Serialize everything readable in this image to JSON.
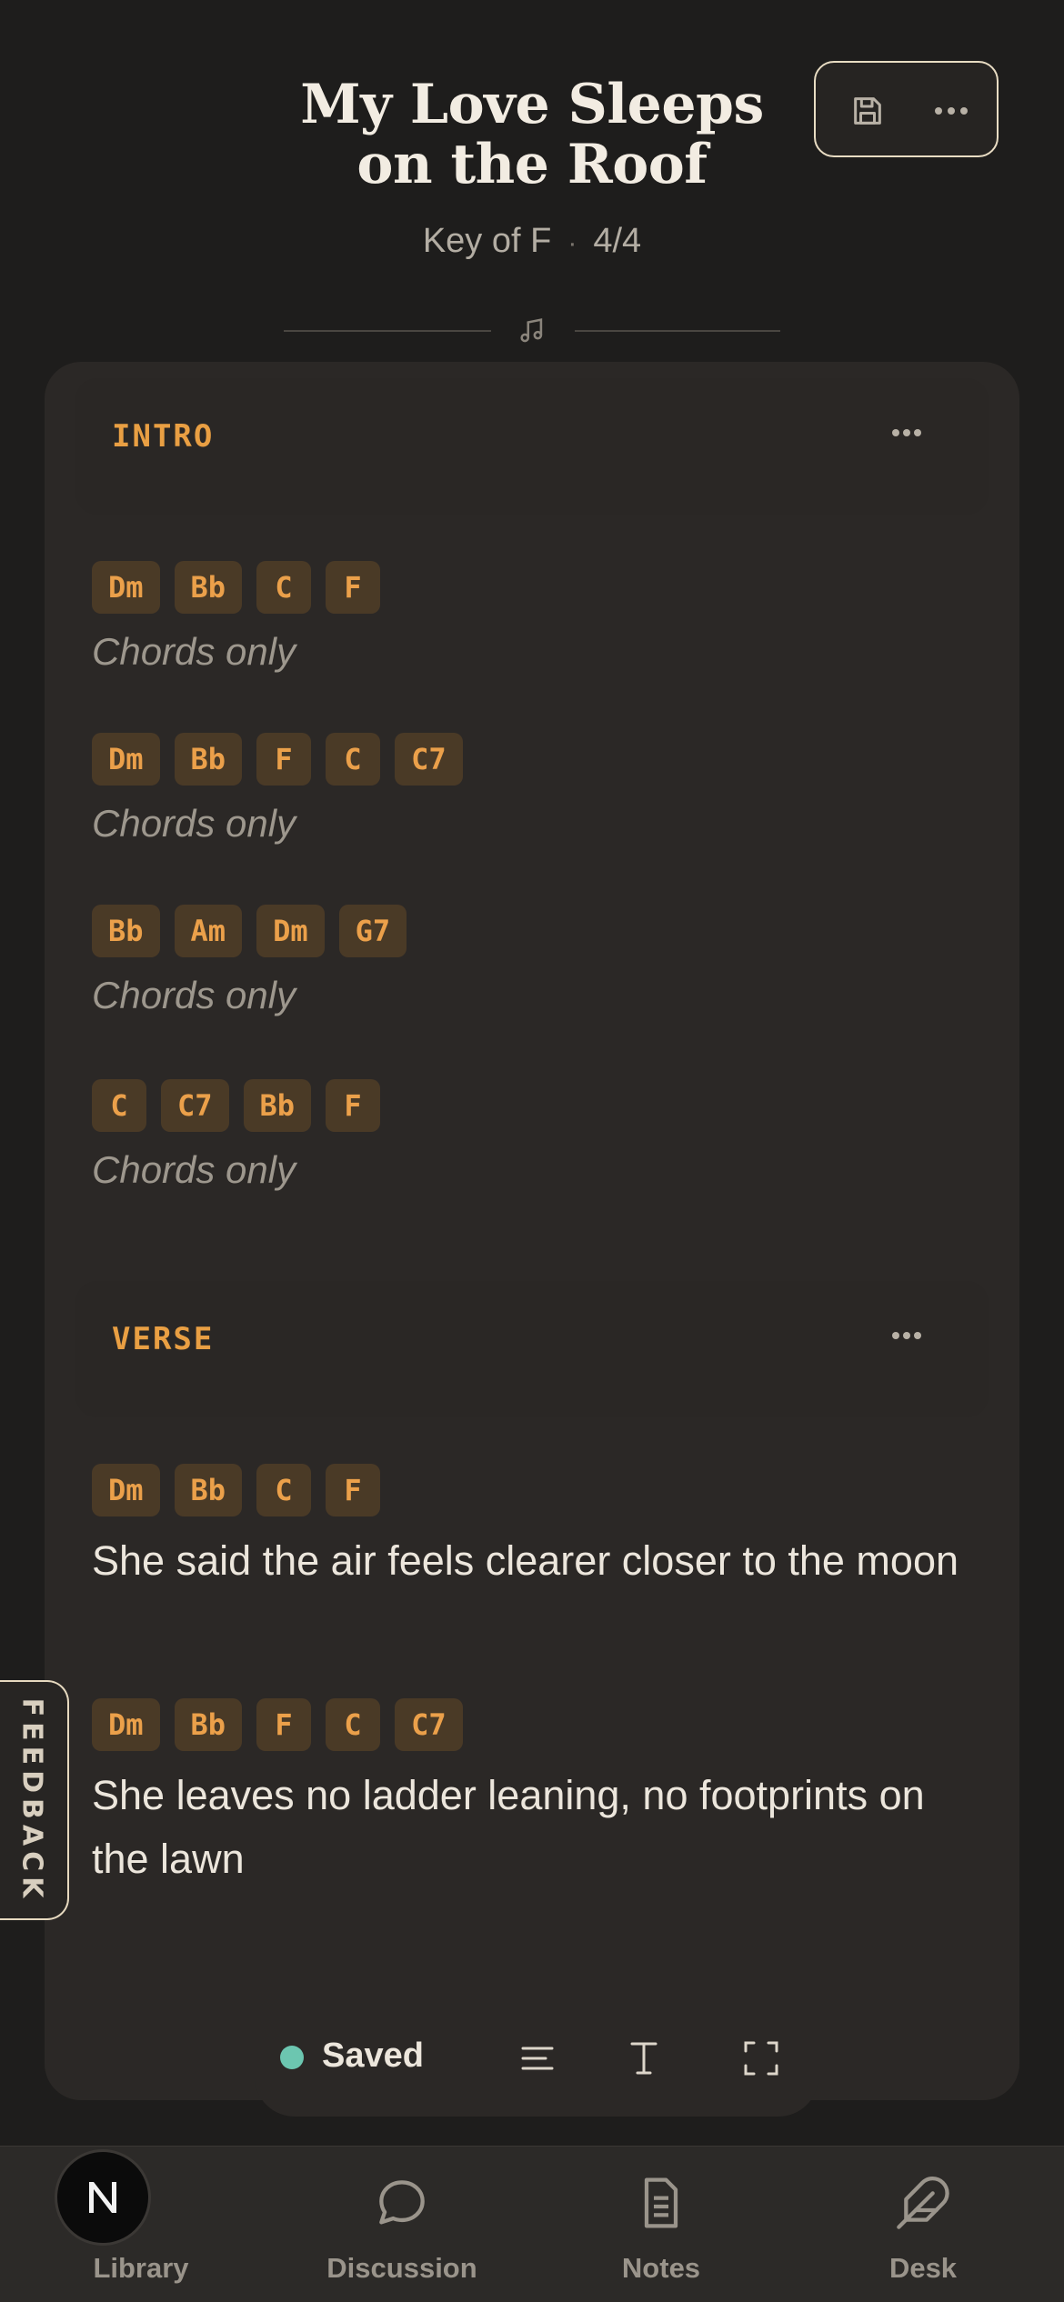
{
  "song": {
    "title_line1": "My Love Sleeps",
    "title_line2": "on the Roof",
    "key": "Key of F",
    "meta_separator": "·",
    "time_signature": "4/4"
  },
  "header_actions": [
    {
      "name": "save",
      "icon": "floppy-disk-icon"
    },
    {
      "name": "more",
      "icon": "ellipsis-icon"
    }
  ],
  "sections": [
    {
      "label": "INTRO",
      "lines": [
        {
          "chords": [
            "Dm",
            "Bb",
            "C",
            "F"
          ],
          "text": "Chords only",
          "placeholder": true
        },
        {
          "chords": [
            "Dm",
            "Bb",
            "F",
            "C",
            "C7"
          ],
          "text": "Chords only",
          "placeholder": true
        },
        {
          "chords": [
            "Bb",
            "Am",
            "Dm",
            "G7"
          ],
          "text": "Chords only",
          "placeholder": true
        },
        {
          "chords": [
            "C",
            "C7",
            "Bb",
            "F"
          ],
          "text": "Chords only",
          "placeholder": true
        }
      ]
    },
    {
      "label": "VERSE",
      "lines": [
        {
          "chords": [
            "Dm",
            "Bb",
            "C",
            "F"
          ],
          "text": "She said the air feels clearer closer to the moon",
          "placeholder": false
        },
        {
          "chords": [
            "Dm",
            "Bb",
            "F",
            "C",
            "C7"
          ],
          "text": "She leaves no ladder leaning, no footprints on the lawn",
          "placeholder": false
        }
      ]
    }
  ],
  "feedback_label": "FEEDBACK",
  "toolbar": {
    "status": "Saved",
    "status_color": "#6cc6b0",
    "tools": [
      "align-left-icon",
      "text-cursor-icon",
      "fullscreen-icon"
    ]
  },
  "nav": {
    "avatar_letter": "N",
    "items": [
      {
        "label": "Library",
        "icon": "library-icon"
      },
      {
        "label": "Discussion",
        "icon": "chat-bubble-icon"
      },
      {
        "label": "Notes",
        "icon": "document-icon"
      },
      {
        "label": "Desk",
        "icon": "feather-icon"
      }
    ]
  },
  "colors": {
    "background": "#1e1d1c",
    "card": "#2b2826",
    "accent": "#e99f43",
    "chord_bg": "#4a3a26"
  }
}
